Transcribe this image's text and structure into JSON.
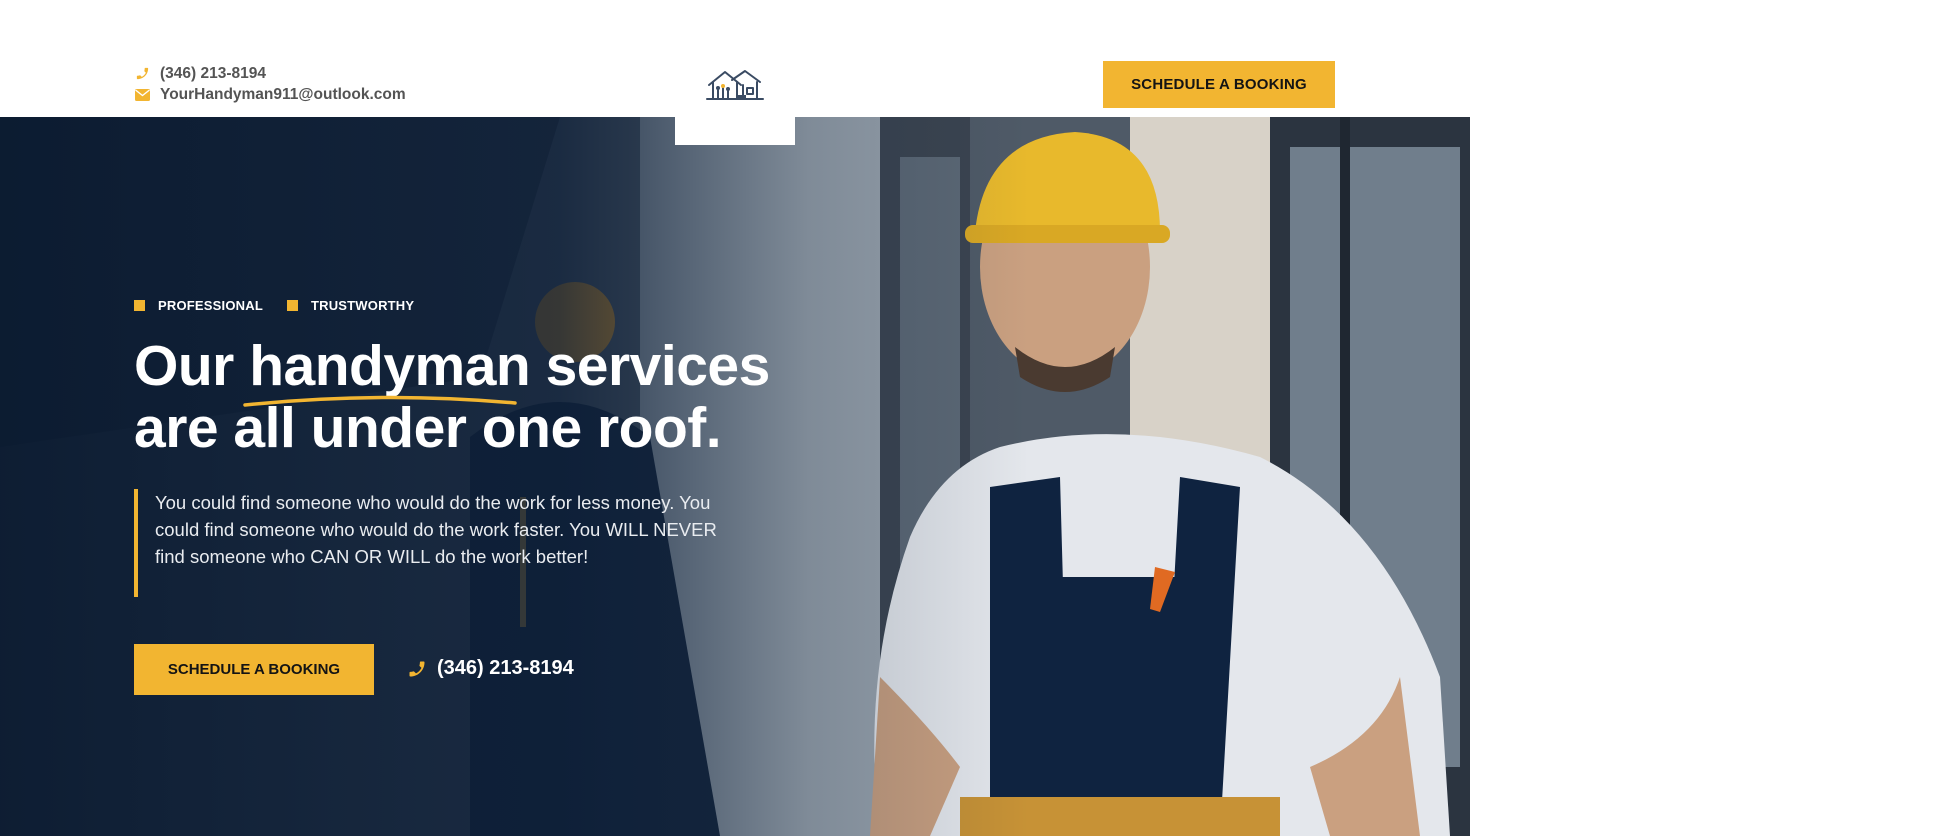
{
  "header": {
    "phone": "(346) 213-8194",
    "email": "YourHandyman911@outlook.com",
    "logo_icon": "house-tools-logo",
    "cta_label": "SCHEDULE A BOOKING"
  },
  "hero": {
    "tags": [
      "PROFESSIONAL",
      "TRUSTWORTHY"
    ],
    "headline": {
      "word1": "Our",
      "highlight": "handyman",
      "word3": "services",
      "line2": "are all under one roof."
    },
    "description": "You could find someone who would do the work for less money. You could find someone who would do the work faster. You WILL NEVER find someone who CAN OR WILL do the work better!",
    "cta_label": "SCHEDULE A BOOKING",
    "phone": "(346) 213-8194"
  },
  "colors": {
    "accent": "#f2b531",
    "hero_overlay": "#0d1f38",
    "text_dark": "#141414"
  }
}
